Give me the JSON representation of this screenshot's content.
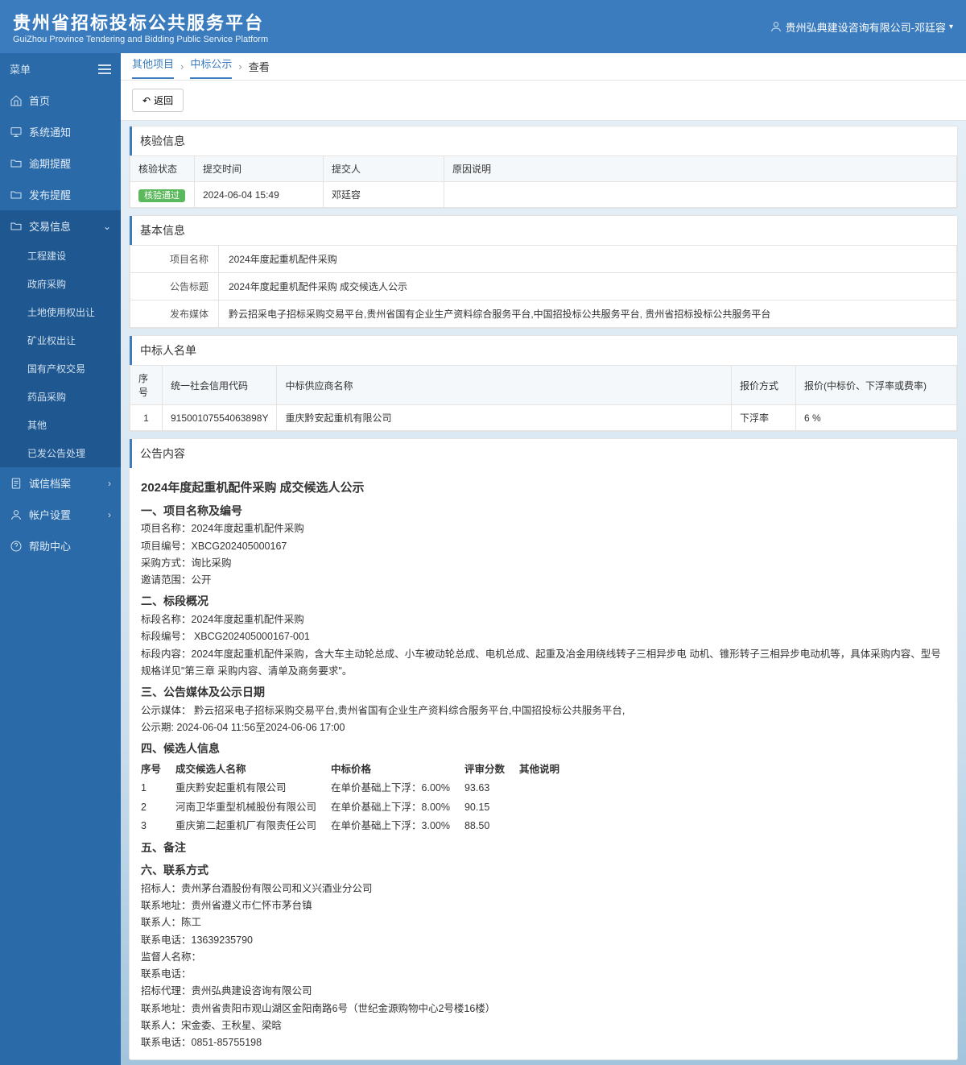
{
  "header": {
    "title": "贵州省招标投标公共服务平台",
    "subtitle": "GuiZhou Province Tendering and Bidding Public Service Platform",
    "user": "贵州弘典建设咨询有限公司-邓廷容"
  },
  "sidebar": {
    "menu_label": "菜单",
    "items": [
      {
        "icon": "home",
        "label": "首页"
      },
      {
        "icon": "monitor",
        "label": "系统通知"
      },
      {
        "icon": "folder",
        "label": "逾期提醒"
      },
      {
        "icon": "folder",
        "label": "发布提醒"
      },
      {
        "icon": "folder",
        "label": "交易信息",
        "expanded": true,
        "children": [
          "工程建设",
          "政府采购",
          "土地使用权出让",
          "矿业权出让",
          "国有产权交易",
          "药品采购",
          "其他",
          "已发公告处理"
        ]
      },
      {
        "icon": "doc",
        "label": "诚信档案",
        "chev": true
      },
      {
        "icon": "user",
        "label": "帐户设置",
        "chev": true
      },
      {
        "icon": "help",
        "label": "帮助中心"
      }
    ]
  },
  "breadcrumb": [
    "其他项目",
    "中标公示",
    "查看"
  ],
  "back_label": "返回",
  "sections": {
    "verify": {
      "title": "核验信息",
      "headers": [
        "核验状态",
        "提交时间",
        "提交人",
        "原因说明"
      ],
      "row": {
        "status": "核验通过",
        "time": "2024-06-04 15:49",
        "submitter": "邓廷容",
        "reason": ""
      }
    },
    "basic": {
      "title": "基本信息",
      "rows": [
        {
          "k": "项目名称",
          "v": "2024年度起重机配件采购"
        },
        {
          "k": "公告标题",
          "v": "2024年度起重机配件采购 成交候选人公示"
        },
        {
          "k": "发布媒体",
          "v": "黔云招采电子招标采购交易平台,贵州省国有企业生产资料综合服务平台,中国招投标公共服务平台, 贵州省招标投标公共服务平台"
        }
      ]
    },
    "winners": {
      "title": "中标人名单",
      "headers": [
        "序号",
        "统一社会信用代码",
        "中标供应商名称",
        "报价方式",
        "报价(中标价、下浮率或费率)"
      ],
      "rows": [
        {
          "no": "1",
          "code": "91500107554063898Y",
          "name": "重庆黔安起重机有限公司",
          "method": "下浮率",
          "price": "6 %"
        }
      ]
    },
    "notice": {
      "title": "公告内容"
    }
  },
  "notice_content": {
    "title": "2024年度起重机配件采购 成交候选人公示",
    "sec1_h": "一、项目名称及编号",
    "sec1": {
      "pname": "项目名称：2024年度起重机配件采购",
      "pcode": "项目编号：XBCG202405000167",
      "method": "采购方式：询比采购",
      "scope": "邀请范围：公开"
    },
    "sec2_h": "二、标段概况",
    "sec2": {
      "bname": "标段名称：2024年度起重机配件采购",
      "bcode": "标段编号： XBCG202405000167-001",
      "bcontent": "标段内容：2024年度起重机配件采购，含大车主动轮总成、小车被动轮总成、电机总成、起重及冶金用绕线转子三相异步电 动机、锥形转子三相异步电动机等，具体采购内容、型号规格详见\"第三章 采购内容、清单及商务要求\"。"
    },
    "sec3_h": "三、公告媒体及公示日期",
    "sec3": {
      "media": "公示媒体： 黔云招采电子招标采购交易平台,贵州省国有企业生产资料综合服务平台,中国招投标公共服务平台,",
      "period": "公示期: 2024-06-04 11:56至2024-06-06 17:00"
    },
    "sec4_h": "四、候选人信息",
    "sec4_headers": [
      "序号",
      "成交候选人名称",
      "中标价格",
      "评审分数",
      "其他说明"
    ],
    "sec4_rows": [
      {
        "no": "1",
        "name": "重庆黔安起重机有限公司",
        "price": "在单价基础上下浮：6.00%",
        "score": "93.63",
        "note": ""
      },
      {
        "no": "2",
        "name": "河南卫华重型机械股份有限公司",
        "price": "在单价基础上下浮：8.00%",
        "score": "90.15",
        "note": ""
      },
      {
        "no": "3",
        "name": "重庆第二起重机厂有限责任公司",
        "price": "在单价基础上下浮：3.00%",
        "score": "88.50",
        "note": ""
      }
    ],
    "sec5_h": "五、备注",
    "sec6_h": "六、联系方式",
    "sec6": [
      "招标人：贵州茅台酒股份有限公司和义兴酒业分公司",
      "联系地址：贵州省遵义市仁怀市茅台镇",
      "联系人：陈工",
      "联系电话：13639235790",
      "监督人名称：",
      "联系电话：",
      "招标代理：贵州弘典建设咨询有限公司",
      "联系地址：贵州省贵阳市观山湖区金阳南路6号（世纪金源购物中心2号楼16楼）",
      "联系人：宋金委、王秋星、梁晗",
      "联系电话：0851-85755198"
    ]
  },
  "chart_data": {
    "type": "table",
    "title": "候选人信息",
    "headers": [
      "序号",
      "成交候选人名称",
      "中标价格(下浮率%)",
      "评审分数"
    ],
    "rows": [
      [
        1,
        "重庆黔安起重机有限公司",
        6.0,
        93.63
      ],
      [
        2,
        "河南卫华重型机械股份有限公司",
        8.0,
        90.15
      ],
      [
        3,
        "重庆第二起重机厂有限责任公司",
        3.0,
        88.5
      ]
    ]
  }
}
